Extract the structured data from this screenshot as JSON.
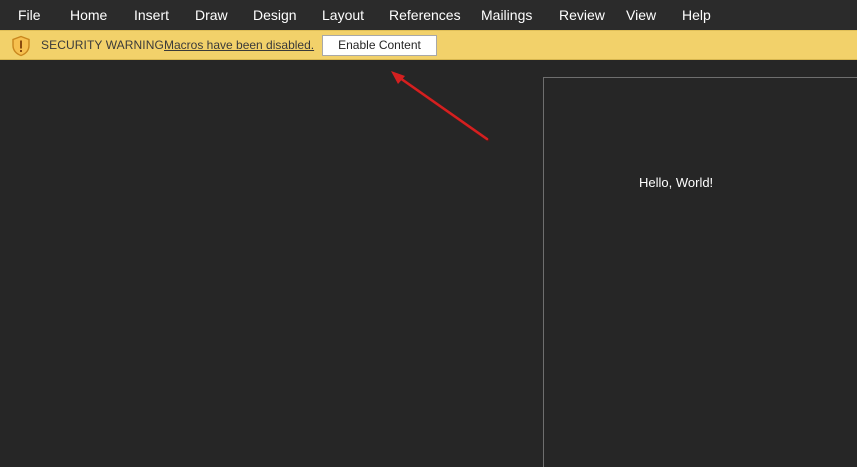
{
  "menu": {
    "items": [
      {
        "label": "File"
      },
      {
        "label": "Home"
      },
      {
        "label": "Insert"
      },
      {
        "label": "Draw"
      },
      {
        "label": "Design"
      },
      {
        "label": "Layout"
      },
      {
        "label": "References"
      },
      {
        "label": "Mailings"
      },
      {
        "label": "Review"
      },
      {
        "label": "View"
      },
      {
        "label": "Help"
      }
    ]
  },
  "security_bar": {
    "icon": "shield-warning-icon",
    "title": "SECURITY WARNING",
    "message": "Macros have been disabled.",
    "button_label": "Enable Content",
    "background_color": "#f2d16a"
  },
  "document": {
    "body_text": "Hello, World!"
  },
  "annotation": {
    "arrow_color": "#d42020"
  }
}
